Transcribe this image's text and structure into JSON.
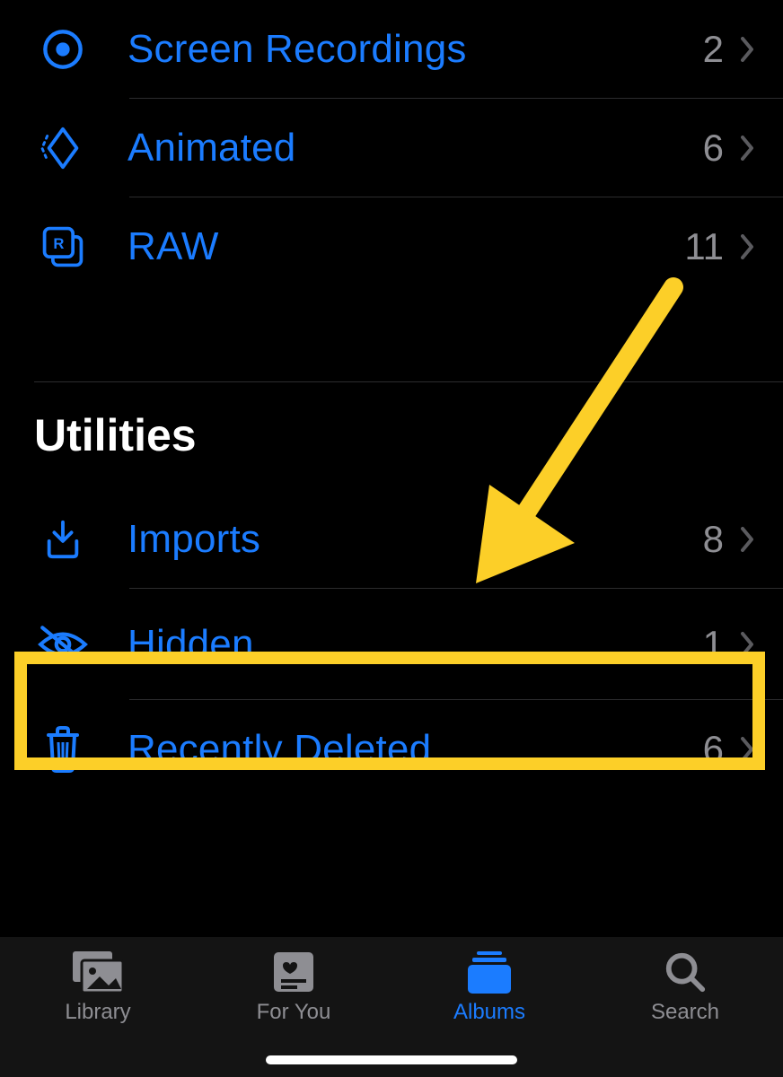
{
  "colors": {
    "accent": "#1b7cff",
    "muted": "#8e8e93",
    "highlight": "#fccf28"
  },
  "media_types": {
    "items": [
      {
        "label": "Screen Recordings",
        "count": "2",
        "icon": "record-icon"
      },
      {
        "label": "Animated",
        "count": "6",
        "icon": "animated-icon"
      },
      {
        "label": "RAW",
        "count": "11",
        "icon": "raw-icon"
      }
    ]
  },
  "utilities": {
    "title": "Utilities",
    "items": [
      {
        "label": "Imports",
        "count": "8",
        "icon": "download-icon"
      },
      {
        "label": "Hidden",
        "count": "1",
        "icon": "eye-slash-icon"
      },
      {
        "label": "Recently Deleted",
        "count": "6",
        "icon": "trash-icon"
      }
    ]
  },
  "tabs": {
    "library": "Library",
    "foryou": "For You",
    "albums": "Albums",
    "search": "Search"
  },
  "annotation": {
    "highlighted_item": "Hidden"
  }
}
